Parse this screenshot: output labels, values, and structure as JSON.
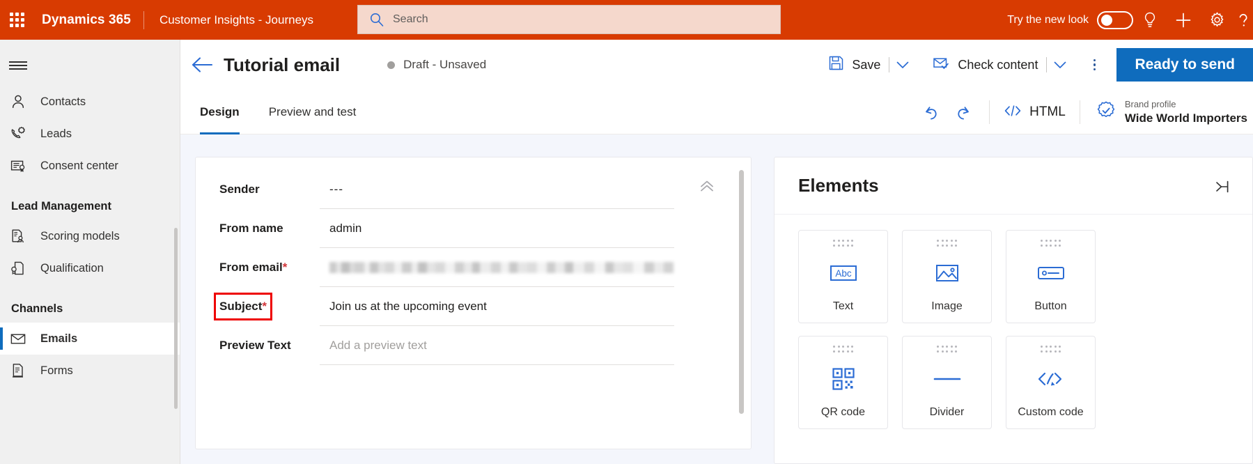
{
  "header": {
    "waffle_icon": "app-launcher-waffle-icon",
    "brand": "Dynamics 365",
    "app_name": "Customer Insights - Journeys",
    "search": {
      "placeholder": "Search",
      "icon": "search-icon"
    },
    "new_look_label": "Try the new look",
    "new_look_toggle_state": "off",
    "icons": [
      "lightbulb-icon",
      "plus-icon",
      "gear-icon",
      "help-question-icon"
    ],
    "background_color": "#d83b01",
    "search_background_color": "#f5d8cc"
  },
  "sidebar": {
    "hamburger_icon": "hamburger-menu-icon",
    "items": [
      {
        "label": "Contacts",
        "icon": "person-icon",
        "selected": false
      },
      {
        "label": "Leads",
        "icon": "lead-phone-icon",
        "selected": false
      },
      {
        "label": "Consent center",
        "icon": "consent-document-icon",
        "selected": false
      }
    ],
    "groups": [
      {
        "title": "Lead Management",
        "items": [
          {
            "label": "Scoring models",
            "icon": "scoring-model-icon",
            "selected": false
          },
          {
            "label": "Qualification",
            "icon": "qualification-icon",
            "selected": false
          }
        ]
      },
      {
        "title": "Channels",
        "items": [
          {
            "label": "Emails",
            "icon": "envelope-icon",
            "selected": true
          },
          {
            "label": "Forms",
            "icon": "form-document-icon",
            "selected": false
          }
        ]
      }
    ],
    "selected_accent_color": "#0f6cbd"
  },
  "command_bar": {
    "back_icon": "back-arrow-icon",
    "record_title": "Tutorial email",
    "status_text": "Draft - Unsaved",
    "status_dot_color": "#a19f9d",
    "save_label": "Save",
    "save_icon": "save-floppy-icon",
    "check_content_label": "Check content",
    "check_content_icon": "envelope-check-icon",
    "overflow_icon": "more-vertical-icon",
    "primary_button_label": "Ready to send",
    "primary_button_color": "#0f6cbd"
  },
  "tabs": [
    {
      "label": "Design",
      "active": true
    },
    {
      "label": "Preview and test",
      "active": false
    }
  ],
  "toolbar": {
    "undo_icon": "undo-icon",
    "redo_icon": "redo-icon",
    "html_label": "HTML",
    "html_icon": "code-brackets-icon",
    "brand_profile_caption": "Brand profile",
    "brand_profile_name": "Wide World Importers",
    "brand_profile_icon": "brand-badge-check-icon"
  },
  "email_form": {
    "collapse_icon": "chevron-double-up-icon",
    "fields": [
      {
        "label": "Sender",
        "required": false,
        "value": "---",
        "is_placeholder": false,
        "is_blurred": false,
        "highlighted": false
      },
      {
        "label": "From name",
        "required": false,
        "value": "admin",
        "is_placeholder": false,
        "is_blurred": false,
        "highlighted": false
      },
      {
        "label": "From email",
        "required": true,
        "value": "",
        "is_placeholder": false,
        "is_blurred": true,
        "highlighted": false
      },
      {
        "label": "Subject",
        "required": true,
        "value": "Join us at the upcoming event",
        "is_placeholder": false,
        "is_blurred": false,
        "highlighted": true
      },
      {
        "label": "Preview Text",
        "required": false,
        "value": "Add a preview text",
        "is_placeholder": true,
        "is_blurred": false,
        "highlighted": false
      }
    ],
    "required_marker": "*",
    "required_color": "#d13438",
    "highlight_color": "#ee0000"
  },
  "elements_panel": {
    "title": "Elements",
    "collapse_icon": "panel-collapse-icon",
    "tiles": [
      {
        "label": "Text",
        "icon": "text-abc-icon"
      },
      {
        "label": "Image",
        "icon": "image-icon"
      },
      {
        "label": "Button",
        "icon": "button-icon"
      },
      {
        "label": "QR code",
        "icon": "qr-code-icon"
      },
      {
        "label": "Divider",
        "icon": "divider-icon"
      },
      {
        "label": "Custom code",
        "icon": "custom-code-icon"
      }
    ],
    "icon_color": "#2b6cd4"
  }
}
